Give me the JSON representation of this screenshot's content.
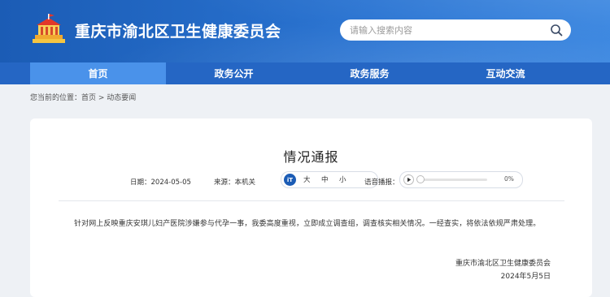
{
  "header": {
    "site_title": "重庆市渝北区卫生健康委员会",
    "logo_icon": "government-emblem-icon",
    "search": {
      "placeholder": "请输入搜索内容",
      "value": "",
      "icon": "search-icon"
    }
  },
  "nav": {
    "items": [
      {
        "label": "首页",
        "active": true
      },
      {
        "label": "政务公开",
        "active": false
      },
      {
        "label": "政务服务",
        "active": false
      },
      {
        "label": "互动交流",
        "active": false
      }
    ]
  },
  "breadcrumb": {
    "prefix": "您当前的位置：",
    "home": "首页",
    "separator": " > ",
    "current": "动态要闻"
  },
  "article": {
    "title": "情况通报",
    "date_label": "日期：",
    "date": "2024-05-05",
    "source_label": "来源：",
    "source": "本机关",
    "font_size": {
      "icon_text": "iT",
      "options": [
        "大",
        "中",
        "小"
      ]
    },
    "audio": {
      "label": "语音播报：",
      "progress_text": "0%",
      "progress": 0
    },
    "body": "针对网上反映重庆安琪儿妇产医院涉嫌参与代孕一事，我委高度重视，立即成立调查组，调查核实相关情况。一经查实，将依法依规严肃处理。",
    "signature_org": "重庆市渝北区卫生健康委员会",
    "signature_date": "2024年5月5日"
  },
  "colors": {
    "header_blue": "#1b5cb5",
    "nav_blue": "#2566c4",
    "nav_active": "#4a92ea",
    "page_bg": "#eef1f5"
  }
}
